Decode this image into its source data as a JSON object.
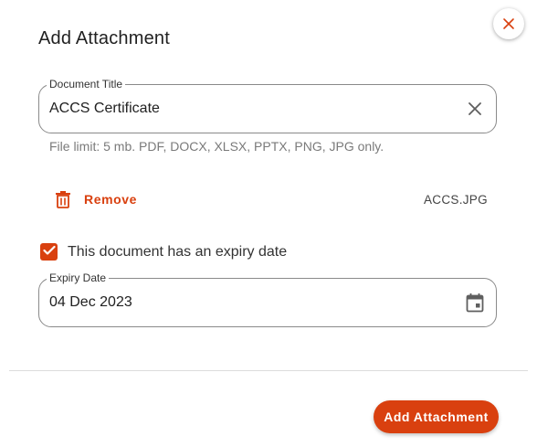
{
  "dialog": {
    "title": "Add Attachment",
    "close_icon": "close-x-icon"
  },
  "document_title_field": {
    "label": "Document Title",
    "value": "ACCS Certificate",
    "clear_icon": "clear-x-icon"
  },
  "hint": "File limit: 5 mb. PDF, DOCX, XLSX, PPTX, PNG, JPG only.",
  "file": {
    "remove_label": "Remove",
    "remove_icon": "trash-icon",
    "filename": "ACCS.JPG"
  },
  "expiry": {
    "checkbox_label": "This document has an expiry date",
    "checked": true,
    "field_label": "Expiry Date",
    "value": "04 Dec 2023",
    "calendar_icon": "calendar-icon"
  },
  "actions": {
    "primary_label": "Add Attachment"
  },
  "colors": {
    "accent": "#d9400f",
    "border": "#8a8a8a",
    "text": "#212121",
    "hint": "#7a7a7a"
  }
}
